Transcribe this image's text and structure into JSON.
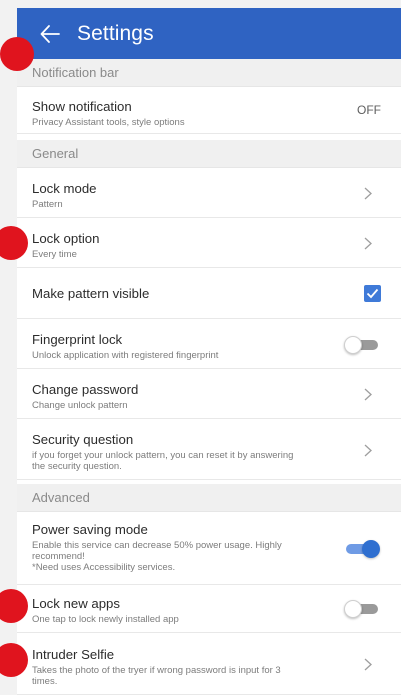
{
  "header": {
    "title": "Settings",
    "back_icon": "arrow-left-icon",
    "bar_color": "#2f63c2"
  },
  "sections": {
    "notification_bar": "Notification bar",
    "general": "General",
    "advanced": "Advanced"
  },
  "rows": {
    "show_notification": {
      "title": "Show notification",
      "subtitle": "Privacy Assistant tools, style options",
      "value": "OFF"
    },
    "lock_mode": {
      "title": "Lock mode",
      "subtitle": "Pattern"
    },
    "lock_option": {
      "title": "Lock option",
      "subtitle": "Every time"
    },
    "make_pattern_visible": {
      "title": "Make pattern visible",
      "checked": true
    },
    "fingerprint_lock": {
      "title": "Fingerprint lock",
      "subtitle": "Unlock application with registered fingerprint",
      "enabled": false
    },
    "change_password": {
      "title": "Change password",
      "subtitle": "Change unlock pattern"
    },
    "security_question": {
      "title": "Security question",
      "subtitle_line1": "if you forget your unlock pattern, you can reset it by answering",
      "subtitle_line2": "the security question."
    },
    "power_saving_mode": {
      "title": "Power saving mode",
      "subtitle_line1": "Enable this service can decrease 50% power usage. Highly",
      "subtitle_line2": "recommend!",
      "subtitle_line3": "*Need uses Accessibility services.",
      "enabled": true
    },
    "lock_new_apps": {
      "title": "Lock new apps",
      "subtitle": "One tap to lock newly installed app",
      "enabled": false
    },
    "intruder_selfie": {
      "title": "Intruder Selfie",
      "subtitle_line1": "Takes the photo of the tryer if wrong password is input for 3",
      "subtitle_line2": "times."
    }
  },
  "colors": {
    "accent": "#3f7ad8",
    "marker": "#e0141e"
  }
}
